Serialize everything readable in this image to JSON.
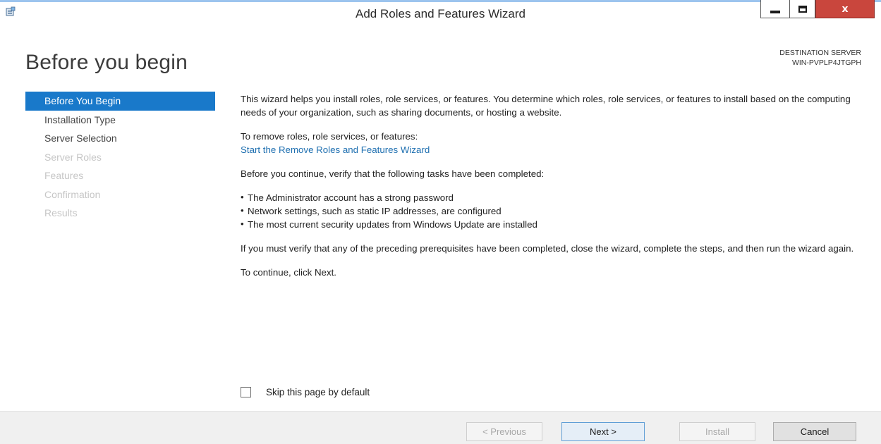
{
  "window": {
    "title": "Add Roles and Features Wizard",
    "close_glyph": "x"
  },
  "header": {
    "heading": "Before you begin",
    "destination_label": "DESTINATION SERVER",
    "destination_server": "WIN-PVPLP4JTGPH"
  },
  "nav": {
    "items": [
      {
        "label": "Before You Begin",
        "state": "active"
      },
      {
        "label": "Installation Type",
        "state": "enabled"
      },
      {
        "label": "Server Selection",
        "state": "enabled"
      },
      {
        "label": "Server Roles",
        "state": "disabled"
      },
      {
        "label": "Features",
        "state": "disabled"
      },
      {
        "label": "Confirmation",
        "state": "disabled"
      },
      {
        "label": "Results",
        "state": "disabled"
      }
    ]
  },
  "content": {
    "intro": "This wizard helps you install roles, role services, or features. You determine which roles, role services, or features to install based on the computing needs of your organization, such as sharing documents, or hosting a website.",
    "remove_text": "To remove roles, role services, or features:",
    "remove_link": "Start the Remove Roles and Features Wizard",
    "verify_text": "Before you continue, verify that the following tasks have been completed:",
    "bullets": [
      "The Administrator account has a strong password",
      "Network settings, such as static IP addresses, are configured",
      "The most current security updates from Windows Update are installed"
    ],
    "prereq_text": "If you must verify that any of the preceding prerequisites have been completed, close the wizard, complete the steps, and then run the wizard again.",
    "continue_text": "To continue, click Next."
  },
  "skip": {
    "label": "Skip this page by default",
    "checked": false
  },
  "buttons": {
    "previous": "< Previous",
    "next": "Next >",
    "install": "Install",
    "cancel": "Cancel"
  },
  "colors": {
    "accent": "#1979ca",
    "link": "#1e6fb0",
    "close_button": "#c9463d",
    "disabled_text": "#c6c6c6"
  },
  "icons": {
    "app": "server-manager-icon",
    "minimize": "minimize-icon",
    "maximize": "maximize-icon",
    "close": "close-icon"
  }
}
